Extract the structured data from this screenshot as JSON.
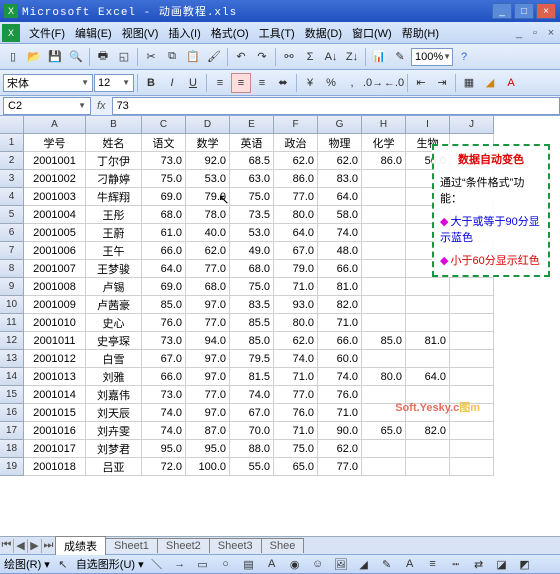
{
  "title": "Microsoft Excel - 动画教程.xls",
  "menus": [
    "文件(F)",
    "编辑(E)",
    "视图(V)",
    "插入(I)",
    "格式(O)",
    "工具(T)",
    "数据(D)",
    "窗口(W)",
    "帮助(H)"
  ],
  "toolbar": {
    "zoom": "100%"
  },
  "format": {
    "font": "宋体",
    "size": "12"
  },
  "namebox": "C2",
  "formula": "73",
  "colHeaders": [
    "A",
    "B",
    "C",
    "D",
    "E",
    "F",
    "G",
    "H",
    "I",
    "J"
  ],
  "tableHeader": [
    "学号",
    "姓名",
    "语文",
    "数学",
    "英语",
    "政治",
    "物理",
    "化学",
    "生物"
  ],
  "chart_data": {
    "type": "table",
    "columns": [
      "学号",
      "姓名",
      "语文",
      "数学",
      "英语",
      "政治",
      "物理",
      "化学",
      "生物"
    ],
    "rows": [
      [
        "2001001",
        "丁尔伊",
        73.0,
        92.0,
        68.5,
        62.0,
        62.0,
        86.0,
        56.0
      ],
      [
        "2001002",
        "刁静婷",
        75.0,
        53.0,
        63.0,
        86.0,
        83.0,
        null,
        null
      ],
      [
        "2001003",
        "牛辉翔",
        69.0,
        79.0,
        75.0,
        77.0,
        64.0,
        null,
        null
      ],
      [
        "2001004",
        "王彤",
        68.0,
        78.0,
        73.5,
        80.0,
        58.0,
        null,
        null
      ],
      [
        "2001005",
        "王蔚",
        61.0,
        40.0,
        53.0,
        64.0,
        74.0,
        null,
        null
      ],
      [
        "2001006",
        "王午",
        66.0,
        62.0,
        49.0,
        67.0,
        48.0,
        null,
        null
      ],
      [
        "2001007",
        "王梦骏",
        64.0,
        77.0,
        68.0,
        79.0,
        66.0,
        null,
        null
      ],
      [
        "2001008",
        "卢锡",
        69.0,
        68.0,
        75.0,
        71.0,
        81.0,
        null,
        null
      ],
      [
        "2001009",
        "卢茜豪",
        85.0,
        97.0,
        83.5,
        93.0,
        82.0,
        null,
        null
      ],
      [
        "2001010",
        "史心",
        76.0,
        77.0,
        85.5,
        80.0,
        71.0,
        null,
        null
      ],
      [
        "2001011",
        "史亭琛",
        73.0,
        94.0,
        85.0,
        62.0,
        66.0,
        85.0,
        81.0
      ],
      [
        "2001012",
        "白雪",
        67.0,
        97.0,
        79.5,
        74.0,
        60.0,
        null,
        null
      ],
      [
        "2001013",
        "刘雅",
        66.0,
        97.0,
        81.5,
        71.0,
        74.0,
        80.0,
        64.0
      ],
      [
        "2001014",
        "刘嘉伟",
        73.0,
        77.0,
        74.0,
        77.0,
        76.0,
        null,
        null
      ],
      [
        "2001015",
        "刘天辰",
        74.0,
        97.0,
        67.0,
        76.0,
        71.0,
        null,
        null
      ],
      [
        "2001016",
        "刘卉雯",
        74.0,
        87.0,
        70.0,
        71.0,
        90.0,
        65.0,
        82.0
      ],
      [
        "2001017",
        "刘梦君",
        95.0,
        95.0,
        88.0,
        75.0,
        62.0,
        null,
        null
      ],
      [
        "2001018",
        "吕亚",
        72.0,
        100.0,
        55.0,
        65.0,
        77.0,
        null,
        null
      ]
    ]
  },
  "overlay": {
    "title": "数据自动变色",
    "line1": "通过“条件格式”功能：",
    "blue": "大于或等于90分显示蓝色",
    "red": "小于60分显示红色"
  },
  "watermark": "Soft.Yesky.c",
  "watermarkSuffix": "图m",
  "tabs": {
    "active": "成绩表",
    "others": [
      "Sheet1",
      "Sheet2",
      "Sheet3",
      "Shee"
    ]
  },
  "status": {
    "draw": "绘图(R)",
    "autoshape": "自选图形(U)"
  }
}
